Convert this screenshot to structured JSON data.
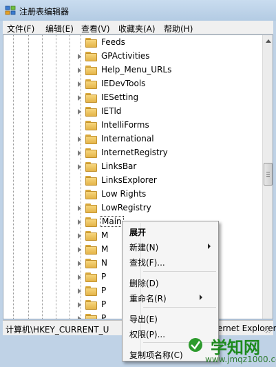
{
  "window": {
    "title": "注册表编辑器",
    "icon": "regedit-icon"
  },
  "menubar": {
    "items": [
      "文件(F)",
      "编辑(E)",
      "查看(V)",
      "收藏夹(A)",
      "帮助(H)"
    ]
  },
  "tree": {
    "items": [
      {
        "label": "Feeds",
        "expandable": false
      },
      {
        "label": "GPActivities",
        "expandable": true
      },
      {
        "label": "Help_Menu_URLs",
        "expandable": true
      },
      {
        "label": "IEDevTools",
        "expandable": true
      },
      {
        "label": "IESetting",
        "expandable": true
      },
      {
        "label": "IETld",
        "expandable": true
      },
      {
        "label": "IntelliForms",
        "expandable": false
      },
      {
        "label": "International",
        "expandable": true
      },
      {
        "label": "InternetRegistry",
        "expandable": true
      },
      {
        "label": "LinksBar",
        "expandable": true
      },
      {
        "label": "LinksExplorer",
        "expandable": false
      },
      {
        "label": "Low Rights",
        "expandable": false
      },
      {
        "label": "LowRegistry",
        "expandable": true
      },
      {
        "label": "Main",
        "expandable": true,
        "selected": true
      },
      {
        "label": "M",
        "expandable": true
      },
      {
        "label": "M",
        "expandable": true
      },
      {
        "label": "N",
        "expandable": true
      },
      {
        "label": "P",
        "expandable": true
      },
      {
        "label": "P",
        "expandable": true
      },
      {
        "label": "P",
        "expandable": true
      },
      {
        "label": "P",
        "expandable": true
      }
    ]
  },
  "status": {
    "path_left": "计算机\\HKEY_CURRENT_U",
    "path_right": "ernet Explorer\\"
  },
  "context_menu": {
    "items": [
      {
        "label": "展开",
        "bold": true,
        "submenu": false
      },
      {
        "label": "新建(N)",
        "bold": false,
        "submenu": true
      },
      {
        "label": "查找(F)...",
        "bold": false,
        "submenu": false
      },
      {
        "label": "删除(D)",
        "bold": false,
        "submenu": false
      },
      {
        "label": "重命名(R)",
        "bold": false,
        "submenu": true
      },
      {
        "label": "导出(E)",
        "bold": false,
        "submenu": false
      },
      {
        "label": "权限(P)...",
        "bold": false,
        "submenu": false
      },
      {
        "label": "复制项名称(C)",
        "bold": false,
        "submenu": false
      }
    ]
  },
  "watermark": {
    "title": "学知网",
    "url": "www.jmqz1000.com"
  },
  "colors": {
    "accent": "#1d8a1d",
    "folder": "#e4b449"
  }
}
